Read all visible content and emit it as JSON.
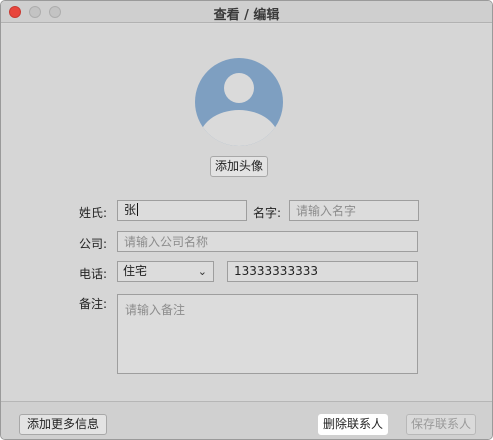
{
  "window": {
    "title": "查看 / 编辑"
  },
  "avatar": {
    "button_label": "添加头像"
  },
  "form": {
    "last_name": {
      "label": "姓氏:",
      "value": "张"
    },
    "first_name": {
      "label": "名字:",
      "placeholder": "请输入名字"
    },
    "company": {
      "label": "公司:",
      "placeholder": "请输入公司名称"
    },
    "phone": {
      "label": "电话:",
      "type": "住宅",
      "value": "13333333333"
    },
    "notes": {
      "label": "备注:",
      "placeholder": "请输入备注"
    }
  },
  "footer": {
    "add_more_label": "添加更多信息",
    "delete_label": "删除联系人",
    "save_label": "保存联系人"
  }
}
